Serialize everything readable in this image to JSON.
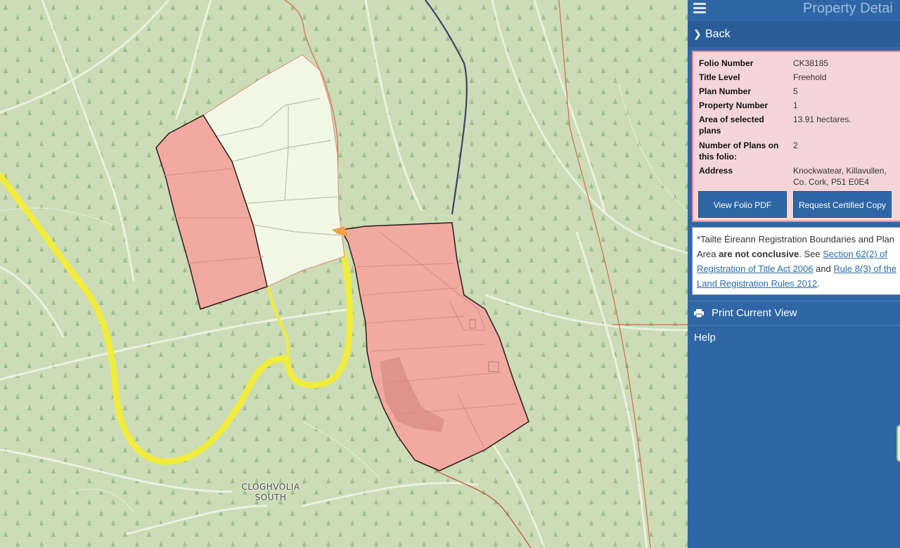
{
  "map": {
    "place_label_line1": "CLOGHVOLIA",
    "place_label_line2": "SOUTH",
    "colors": {
      "background": "#cbdcb6",
      "selected_parcel_fill": "#f1aaa0",
      "unselected_parcel_fill": "#f3f8e6",
      "road_yellow": "#f1ec3c",
      "boundary_red": "#d75c4a",
      "river_blue": "#3f3f6e"
    }
  },
  "panel": {
    "title": "Property Detai",
    "menu_icon": "hamburger-menu-icon",
    "back_label": "Back",
    "details": {
      "folio_number_label": "Folio Number",
      "folio_number_value": "CK38185",
      "title_level_label": "Title Level",
      "title_level_value": "Freehold",
      "plan_number_label": "Plan Number",
      "plan_number_value": "5",
      "property_number_label": "Property Number",
      "property_number_value": "1",
      "area_label": "Area of selected plans",
      "area_value": "13.91 hectares.",
      "num_plans_label": "Number of Plans on this folio:",
      "num_plans_value": "2",
      "address_label": "Address",
      "address_value": "Knockwatear, Killavullen, Co. Cork, P51 E0E4"
    },
    "buttons": {
      "view_pdf": "View Folio PDF",
      "request_copy": "Request Certified Copy"
    },
    "disclaimer": {
      "part1": "*Tailte Éireann Registration Boundaries and Plan Area ",
      "bold": "are not conclusive",
      "part2": ". See ",
      "link1": "Section 62(2) of Registration of Title Act 2006",
      "part3": " and ",
      "link2": "Rule 8(3) of the Land Registration Rules 2012",
      "part4": "."
    },
    "print_label": "Print Current View",
    "help_label": "Help",
    "colors": {
      "panel_bg": "#2f66a6",
      "details_bg": "#f4d6d8",
      "details_border": "#e98a8f"
    }
  }
}
